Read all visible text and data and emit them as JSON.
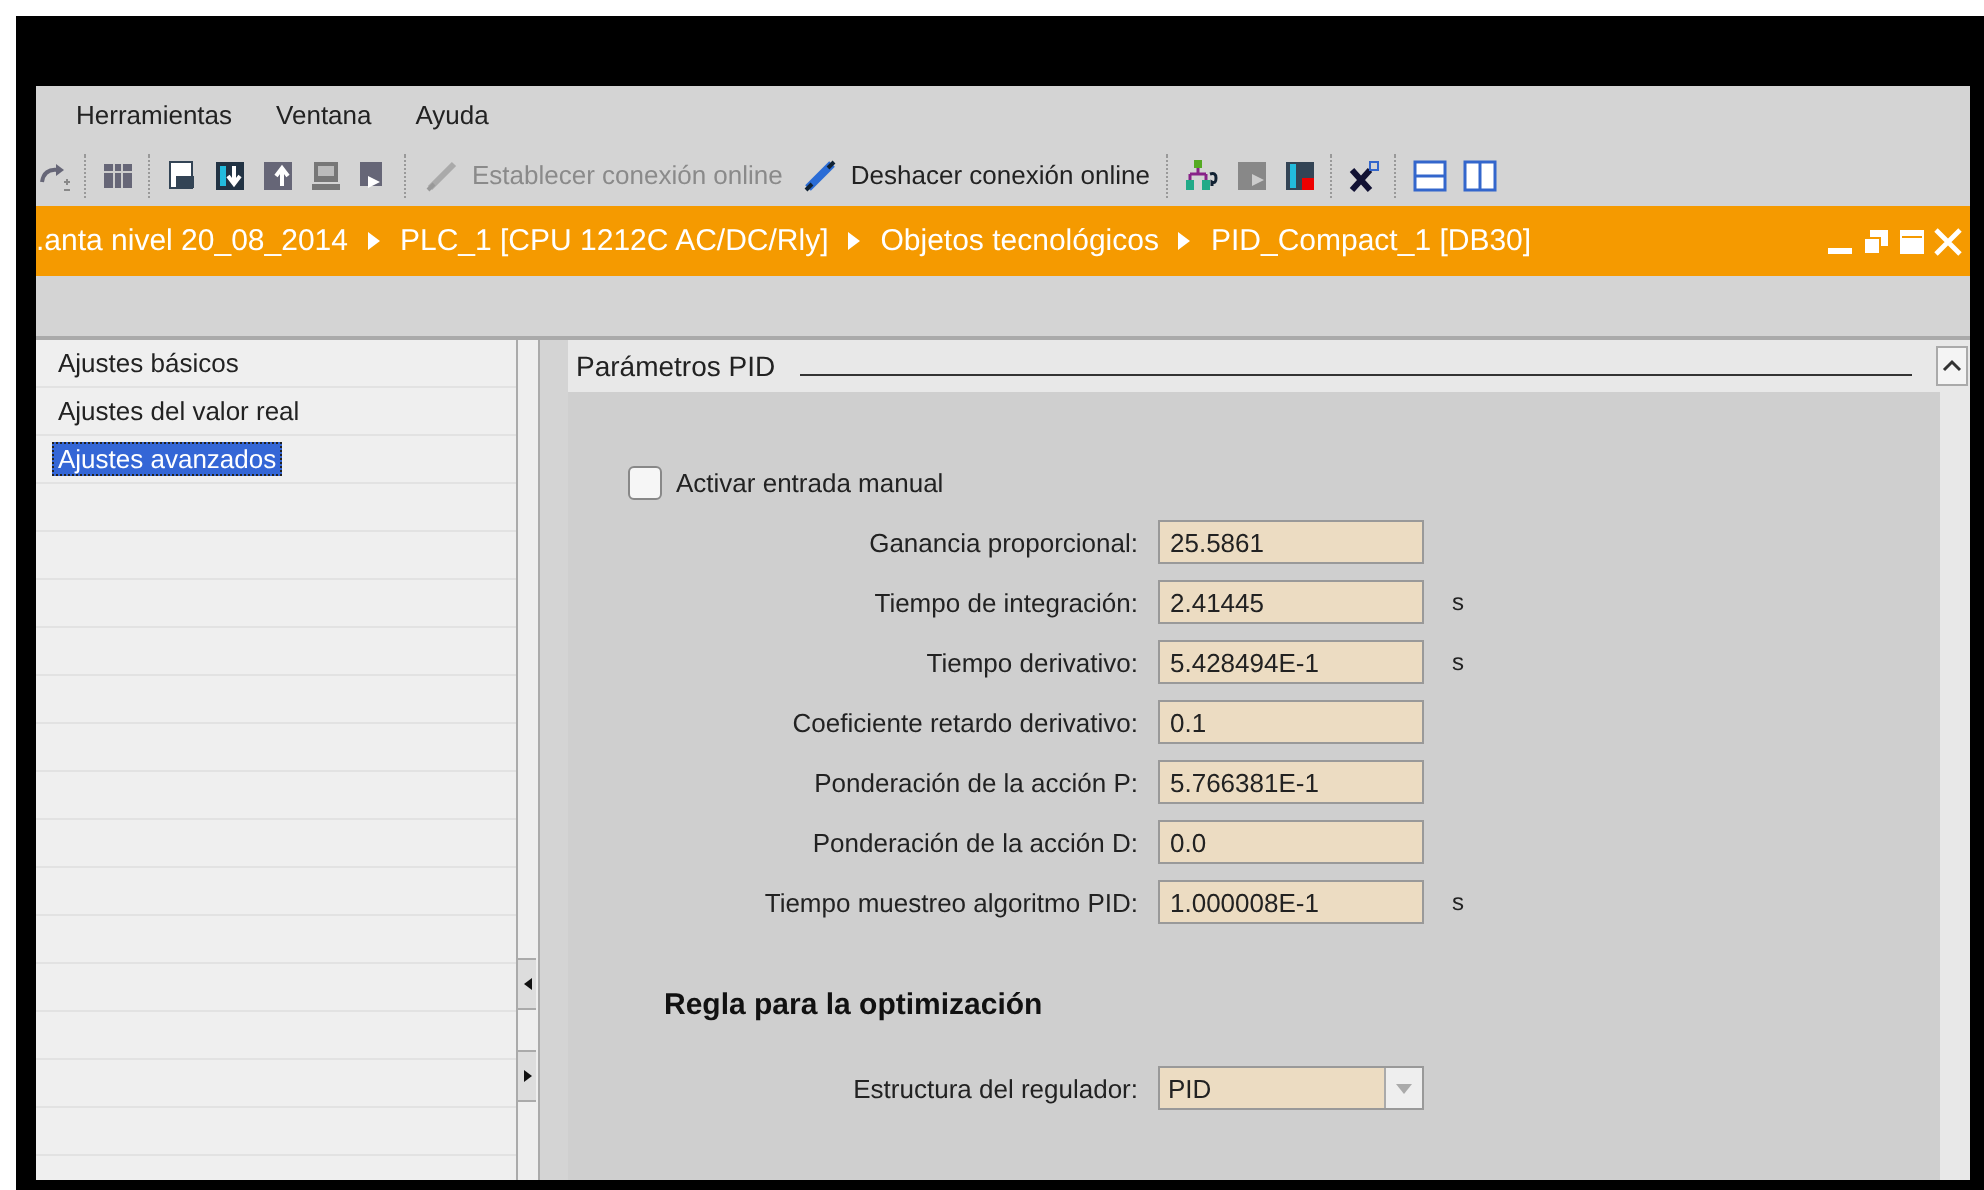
{
  "menu": [
    "Herramientas",
    "Ventana",
    "Ayuda"
  ],
  "toolbar": {
    "connect": {
      "label": "Establecer conexión online",
      "disabled": true
    },
    "disconnect": {
      "label": "Deshacer conexión online",
      "disabled": false
    }
  },
  "breadcrumb": [
    ".anta nivel 20_08_2014",
    "PLC_1 [CPU 1212C AC/DC/Rly]",
    "Objetos tecnológicos",
    "PID_Compact_1 [DB30]"
  ],
  "sidebar": {
    "items": [
      {
        "label": "Ajustes básicos",
        "selected": false
      },
      {
        "label": "Ajustes del valor real",
        "selected": false
      },
      {
        "label": "Ajustes avanzados",
        "selected": true
      }
    ]
  },
  "section": {
    "title": "Parámetros PID",
    "manual_input": {
      "label": "Activar entrada manual",
      "checked": false
    },
    "fields": [
      {
        "label": "Ganancia proporcional:",
        "value": "25.5861"
      },
      {
        "label": "Tiempo de integración:",
        "value": "2.41445",
        "unit": "s"
      },
      {
        "label": "Tiempo derivativo:",
        "value": "5.428494E-1",
        "unit": "s"
      },
      {
        "label": "Coeficiente retardo derivativo:",
        "value": "0.1"
      },
      {
        "label": "Ponderación de la acción P:",
        "value": "5.766381E-1"
      },
      {
        "label": "Ponderación de la acción D:",
        "value": "0.0"
      },
      {
        "label": "Tiempo muestreo algoritmo PID:",
        "value": "1.000008E-1",
        "unit": "s"
      }
    ],
    "optimization": {
      "title": "Regla para la optimización",
      "label": "Estructura del regulador:",
      "value": "PID"
    }
  }
}
